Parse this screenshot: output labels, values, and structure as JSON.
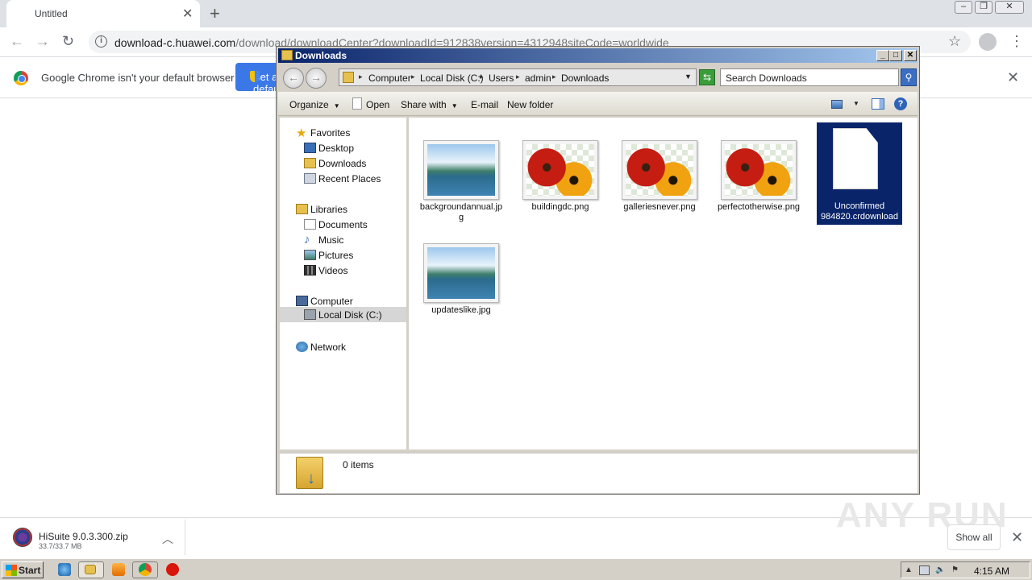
{
  "browser": {
    "tab_title": "Untitled",
    "url_host": "download-c.huawei.com",
    "url_path": "/download/downloadCenter?downloadId=912838version=4312948siteCode=worldwide",
    "infobar_text": "Google Chrome isn't your default browser",
    "set_default_label": "Set as default"
  },
  "explorer": {
    "title": "Downloads",
    "breadcrumbs": [
      "Computer",
      "Local Disk (C:)",
      "Users",
      "admin",
      "Downloads"
    ],
    "search_placeholder": "Search Downloads",
    "commands": {
      "organize": "Organize",
      "open": "Open",
      "share_with": "Share with",
      "email": "E-mail",
      "new_folder": "New folder"
    },
    "nav": {
      "favorites": "Favorites",
      "desktop": "Desktop",
      "downloads": "Downloads",
      "recent_places": "Recent Places",
      "libraries": "Libraries",
      "documents": "Documents",
      "music": "Music",
      "pictures": "Pictures",
      "videos": "Videos",
      "computer": "Computer",
      "local_disk": "Local Disk (C:)",
      "network": "Network"
    },
    "files": [
      {
        "name": "backgroundannual.jpg",
        "kind": "landscape"
      },
      {
        "name": "buildingdc.png",
        "kind": "flower"
      },
      {
        "name": "galleriesnever.png",
        "kind": "flower"
      },
      {
        "name": "perfectotherwise.png",
        "kind": "flower"
      },
      {
        "name": "Unconfirmed 984820.crdownload",
        "kind": "document",
        "selected": true
      },
      {
        "name": "updateslike.jpg",
        "kind": "landscape"
      }
    ],
    "status": "0 items"
  },
  "downloads_shelf": {
    "file_name": "HiSuite 9.0.3.300.zip",
    "file_size": "33.7/33.7 MB",
    "show_all": "Show all",
    "watermark": "ANY RUN"
  },
  "taskbar": {
    "start_label": "Start",
    "clock": "4:15 AM"
  }
}
